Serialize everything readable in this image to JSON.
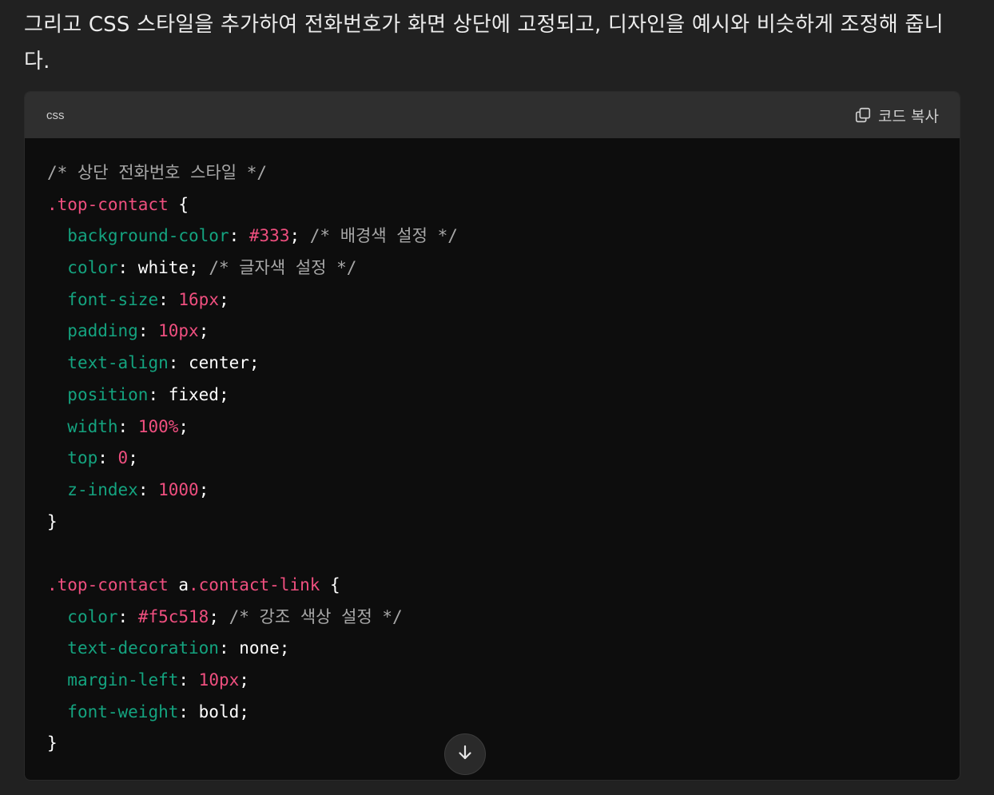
{
  "intro": {
    "text": "그리고 CSS 스타일을 추가하여 전화번호가 화면 상단에 고정되고, 디자인을 예시와 비슷하게 조정해 줍니다."
  },
  "code_block": {
    "language": "css",
    "copy_label": "코드 복사",
    "lines": [
      [
        {
          "t": "com",
          "v": "/* 상단 전화번호 스타일 */"
        }
      ],
      [
        {
          "t": "sel",
          "v": ".top-contact"
        },
        {
          "t": "plain",
          "v": " {"
        }
      ],
      [
        {
          "t": "plain",
          "v": "  "
        },
        {
          "t": "prop",
          "v": "background-color"
        },
        {
          "t": "plain",
          "v": ": "
        },
        {
          "t": "num",
          "v": "#333"
        },
        {
          "t": "plain",
          "v": "; "
        },
        {
          "t": "com",
          "v": "/* 배경색 설정 */"
        }
      ],
      [
        {
          "t": "plain",
          "v": "  "
        },
        {
          "t": "prop",
          "v": "color"
        },
        {
          "t": "plain",
          "v": ": white; "
        },
        {
          "t": "com",
          "v": "/* 글자색 설정 */"
        }
      ],
      [
        {
          "t": "plain",
          "v": "  "
        },
        {
          "t": "prop",
          "v": "font-size"
        },
        {
          "t": "plain",
          "v": ": "
        },
        {
          "t": "num",
          "v": "16px"
        },
        {
          "t": "plain",
          "v": ";"
        }
      ],
      [
        {
          "t": "plain",
          "v": "  "
        },
        {
          "t": "prop",
          "v": "padding"
        },
        {
          "t": "plain",
          "v": ": "
        },
        {
          "t": "num",
          "v": "10px"
        },
        {
          "t": "plain",
          "v": ";"
        }
      ],
      [
        {
          "t": "plain",
          "v": "  "
        },
        {
          "t": "prop",
          "v": "text-align"
        },
        {
          "t": "plain",
          "v": ": center;"
        }
      ],
      [
        {
          "t": "plain",
          "v": "  "
        },
        {
          "t": "prop",
          "v": "position"
        },
        {
          "t": "plain",
          "v": ": fixed;"
        }
      ],
      [
        {
          "t": "plain",
          "v": "  "
        },
        {
          "t": "prop",
          "v": "width"
        },
        {
          "t": "plain",
          "v": ": "
        },
        {
          "t": "num",
          "v": "100%"
        },
        {
          "t": "plain",
          "v": ";"
        }
      ],
      [
        {
          "t": "plain",
          "v": "  "
        },
        {
          "t": "prop",
          "v": "top"
        },
        {
          "t": "plain",
          "v": ": "
        },
        {
          "t": "num",
          "v": "0"
        },
        {
          "t": "plain",
          "v": ";"
        }
      ],
      [
        {
          "t": "plain",
          "v": "  "
        },
        {
          "t": "prop",
          "v": "z-index"
        },
        {
          "t": "plain",
          "v": ": "
        },
        {
          "t": "num",
          "v": "1000"
        },
        {
          "t": "plain",
          "v": ";"
        }
      ],
      [
        {
          "t": "plain",
          "v": "}"
        }
      ],
      [
        {
          "t": "plain",
          "v": " "
        }
      ],
      [
        {
          "t": "sel",
          "v": ".top-contact"
        },
        {
          "t": "plain",
          "v": " a"
        },
        {
          "t": "sel",
          "v": ".contact-link"
        },
        {
          "t": "plain",
          "v": " {"
        }
      ],
      [
        {
          "t": "plain",
          "v": "  "
        },
        {
          "t": "prop",
          "v": "color"
        },
        {
          "t": "plain",
          "v": ": "
        },
        {
          "t": "num",
          "v": "#f5c518"
        },
        {
          "t": "plain",
          "v": "; "
        },
        {
          "t": "com",
          "v": "/* 강조 색상 설정 */"
        }
      ],
      [
        {
          "t": "plain",
          "v": "  "
        },
        {
          "t": "prop",
          "v": "text-decoration"
        },
        {
          "t": "plain",
          "v": ": none;"
        }
      ],
      [
        {
          "t": "plain",
          "v": "  "
        },
        {
          "t": "prop",
          "v": "margin-left"
        },
        {
          "t": "plain",
          "v": ": "
        },
        {
          "t": "num",
          "v": "10px"
        },
        {
          "t": "plain",
          "v": ";"
        }
      ],
      [
        {
          "t": "plain",
          "v": "  "
        },
        {
          "t": "prop",
          "v": "font-weight"
        },
        {
          "t": "plain",
          "v": ": bold;"
        }
      ],
      [
        {
          "t": "plain",
          "v": "}"
        }
      ]
    ]
  },
  "icons": {
    "copy": "copy-icon",
    "scroll": "arrow-down-icon"
  },
  "colors": {
    "page_bg": "#212121",
    "code_bg": "#0d0d0d",
    "header_bg": "#2f2f2f",
    "comment": "#a8a8a8",
    "selector": "#ef4f7f",
    "property": "#14a37f",
    "value_number": "#ef4f7f",
    "plain": "#ffffff"
  }
}
